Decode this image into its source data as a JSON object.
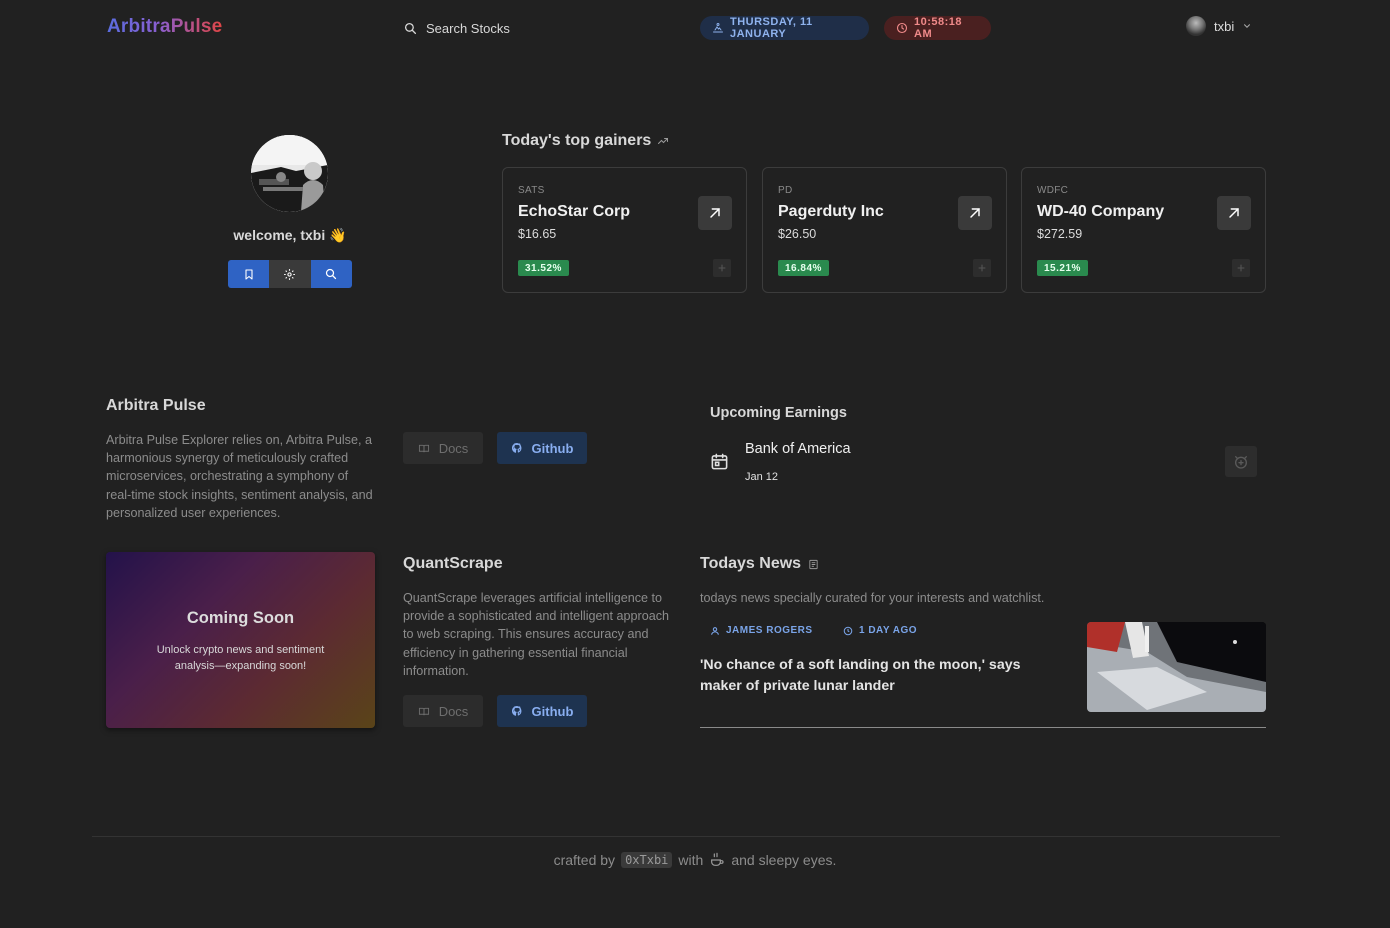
{
  "header": {
    "logo": "ArbitraPulse",
    "search_label": "Search Stocks",
    "date": "THURSDAY, 11 JANUARY",
    "time": "10:58:18 AM",
    "username": "txbi"
  },
  "profile": {
    "welcome": "welcome, txbi 👋"
  },
  "gainers": {
    "title": "Today's top gainers",
    "cards": [
      {
        "symbol": "SATS",
        "name": "EchoStar Corp",
        "price": "$16.65",
        "change": "31.52%"
      },
      {
        "symbol": "PD",
        "name": "Pagerduty Inc",
        "price": "$26.50",
        "change": "16.84%"
      },
      {
        "symbol": "WDFC",
        "name": "WD-40 Company",
        "price": "$272.59",
        "change": "15.21%"
      }
    ]
  },
  "arbitra": {
    "title": "Arbitra Pulse",
    "description": "Arbitra Pulse Explorer relies on, Arbitra Pulse, a harmonious synergy of meticulously crafted microservices, orchestrating a symphony of real-time stock insights, sentiment analysis, and personalized user experiences.",
    "docs_label": "Docs",
    "github_label": "Github"
  },
  "earnings": {
    "title": "Upcoming Earnings",
    "company": "Bank of America",
    "date": "Jan 12"
  },
  "coming_soon": {
    "title": "Coming Soon",
    "subtitle": "Unlock crypto news and sentiment analysis—expanding soon!"
  },
  "quantscrape": {
    "title": "QuantScrape",
    "description": "QuantScrape leverages artificial intelligence to provide a sophisticated and intelligent approach to web scraping. This ensures accuracy and efficiency in gathering essential financial information.",
    "docs_label": "Docs",
    "github_label": "Github"
  },
  "news": {
    "title": "Todays News",
    "subtitle": "todays news specially curated for your interests and watchlist.",
    "author": "JAMES ROGERS",
    "age": "1 DAY AGO",
    "headline": "'No chance of a soft landing on the moon,' says maker of private lunar lander"
  },
  "footer": {
    "prefix": "crafted by",
    "handle": "0xTxbi",
    "with": "with",
    "suffix": "and sleepy eyes."
  },
  "colors": {
    "background": "#212121",
    "accent_blue": "#2f63c4",
    "gain_green": "#2a8a4e",
    "time_red": "#f08a8a"
  }
}
